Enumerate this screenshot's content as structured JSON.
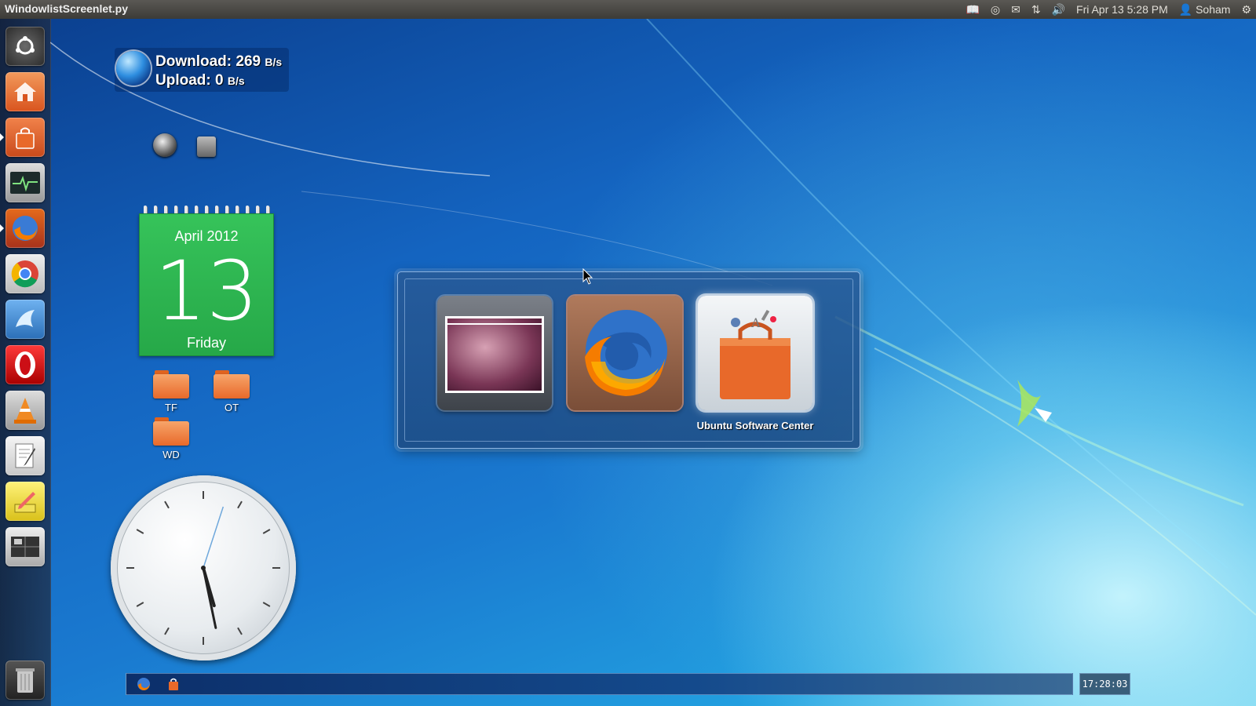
{
  "topbar": {
    "app_title": "WindowlistScreenlet.py",
    "datetime": "Fri Apr 13  5:28 PM",
    "user": "Soham",
    "tray_icons": [
      "book-icon",
      "ubuntu-one-icon",
      "mail-icon",
      "network-icon",
      "volume-icon",
      "user-icon",
      "session-gear-icon"
    ]
  },
  "launcher": {
    "items": [
      "dash-home",
      "home-folder",
      "software-center",
      "system-monitor",
      "firefox",
      "chrome",
      "wine-app",
      "opera",
      "vlc",
      "text-editor",
      "notes",
      "workspace-switcher",
      "trash"
    ]
  },
  "network_widget": {
    "download_label": "Download:",
    "download_value": "269",
    "download_unit": "B/s",
    "upload_label": "Upload:",
    "upload_value": "0",
    "upload_unit": "B/s"
  },
  "calendar": {
    "month_year": "April 2012",
    "day": "13",
    "weekday": "Friday"
  },
  "desktop_folders": [
    "TF",
    "OT",
    "WD"
  ],
  "clock": {
    "hour": 5,
    "minute": 28,
    "second": 3
  },
  "switcher": {
    "items": [
      "desktop-window",
      "firefox",
      "Ubuntu Software Center"
    ],
    "selected_label": "Ubuntu Software Center"
  },
  "taskbar": {
    "time": "17:28:03"
  },
  "colors": {
    "accent": "#e8692a",
    "calendar": "#2fb552",
    "panel": "#3c3b37"
  }
}
